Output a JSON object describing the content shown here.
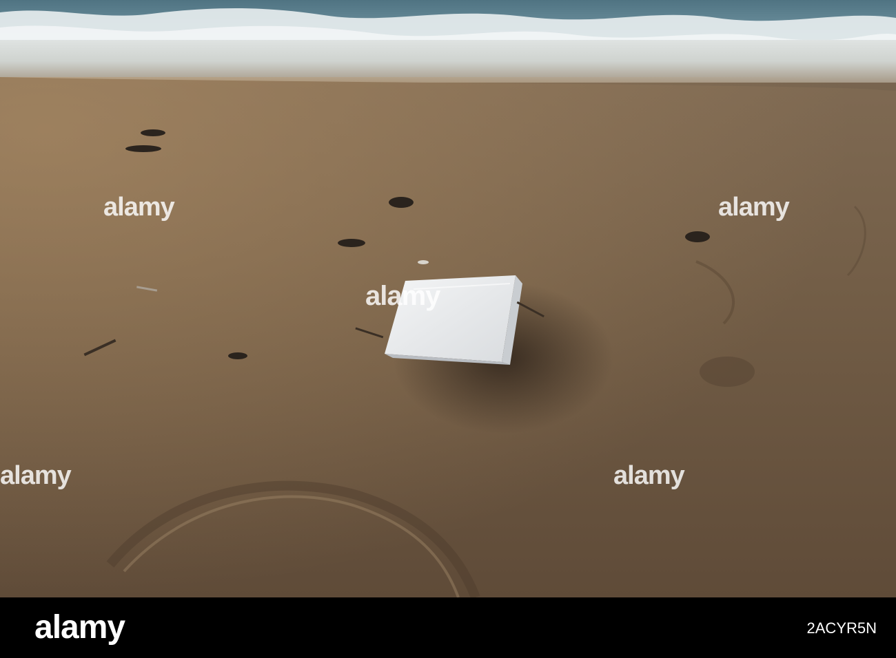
{
  "photo": {
    "subject": "foam-block-on-beach-sand",
    "colors": {
      "sand": "#6e5a45",
      "sea": "#4f7382",
      "foam": "#e6ebee",
      "object": "#ecedee",
      "shadow": "#3b2e22"
    }
  },
  "watermark": {
    "text": "alamy"
  },
  "footer": {
    "logo_text": "alamy",
    "image_id": "2ACYR5N"
  }
}
